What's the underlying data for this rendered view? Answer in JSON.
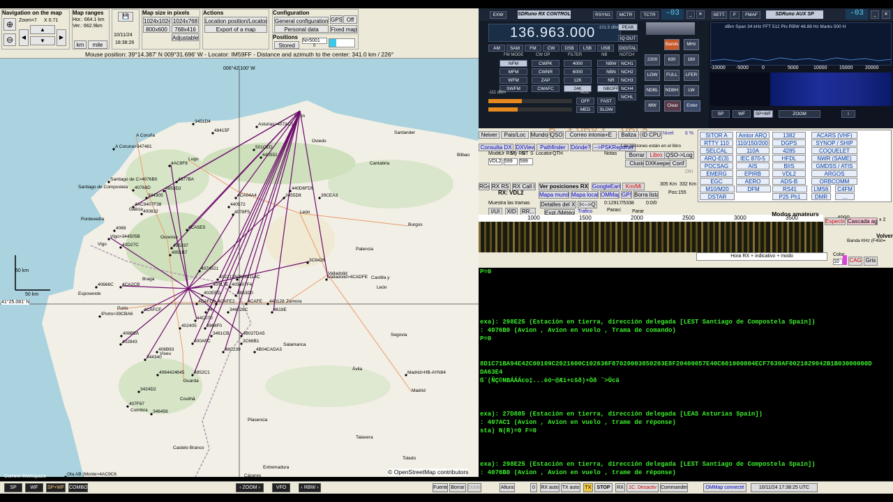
{
  "map": {
    "nav_title": "Navigation on the map",
    "zoom_readout": "Zoom=7",
    "zoom_x": "X 0.71",
    "ranges_title": "Map ranges",
    "hor": "Hor.: 664.1 km",
    "ver": "Ver.: 662.9km",
    "unit_km": "km",
    "unit_mile": "mile",
    "date": "10/11/24",
    "time": "18:38:26",
    "size_title": "Map size in pixels",
    "sizes": [
      "1024x1024",
      "1024x768",
      "800x600",
      "768x416"
    ],
    "adjustable": "Adjustable",
    "actions_title": "Actions",
    "actions": [
      "Location position/Locator",
      "Export of a map"
    ],
    "config_title": "Configuration",
    "config": [
      "General configuration",
      "Personal data"
    ],
    "gps": "GPS",
    "off": "Off",
    "fixed_map": "Fixed map",
    "positions_title": "Positions",
    "stored": "Stored",
    "n_value": "N=5001",
    "n_zero": "0",
    "mouse_pos": "Mouse position: 39°14.387' N 009°31.696' W - Locator: IM59FF - Distance and azimuth to the center: 341.0 km / 226°",
    "lon_label": "006°42.100' W",
    "lat_label": "41°25.081' N",
    "scale_v": "50 km",
    "scale_h": "50 km",
    "osm": "© OpenStreetMap contributors",
    "cities": [
      {
        "t": "A Coruña",
        "x": 195,
        "y": 112
      },
      {
        "t": "Santiago de Compostela",
        "x": 112,
        "y": 186
      },
      {
        "t": "Lugo",
        "x": 270,
        "y": 146
      },
      {
        "t": "Ourense",
        "x": 230,
        "y": 258
      },
      {
        "t": "Vigo",
        "x": 140,
        "y": 268
      },
      {
        "t": "Pontevedra",
        "x": 116,
        "y": 232
      },
      {
        "t": "Oviedo",
        "x": 447,
        "y": 120
      },
      {
        "t": "Gijón",
        "x": 422,
        "y": 84
      },
      {
        "t": "Santander",
        "x": 565,
        "y": 108
      },
      {
        "t": "Cantabria",
        "x": 530,
        "y": 152
      },
      {
        "t": "León",
        "x": 430,
        "y": 222
      },
      {
        "t": "Burgos",
        "x": 585,
        "y": 240
      },
      {
        "t": "Palencia",
        "x": 510,
        "y": 275
      },
      {
        "t": "Valladolid",
        "x": 470,
        "y": 310
      },
      {
        "t": "Zamora",
        "x": 410,
        "y": 350
      },
      {
        "t": "Salamanca",
        "x": 406,
        "y": 412
      },
      {
        "t": "Segovia",
        "x": 560,
        "y": 398
      },
      {
        "t": "Ávila",
        "x": 505,
        "y": 447
      },
      {
        "t": "Madrid",
        "x": 590,
        "y": 478
      },
      {
        "t": "Castilla y",
        "x": 532,
        "y": 316
      },
      {
        "t": "León",
        "x": 540,
        "y": 330
      },
      {
        "t": "Porto",
        "x": 168,
        "y": 360
      },
      {
        "t": "Braga",
        "x": 204,
        "y": 318
      },
      {
        "t": "Guarda",
        "x": 263,
        "y": 464
      },
      {
        "t": "Coimbra",
        "x": 187,
        "y": 506
      },
      {
        "t": "Viseu",
        "x": 229,
        "y": 425
      },
      {
        "t": "Covilhã",
        "x": 258,
        "y": 490
      },
      {
        "t": "Castelo Branco",
        "x": 248,
        "y": 560
      },
      {
        "t": "Extremadura",
        "x": 377,
        "y": 588
      },
      {
        "t": "Plasencia",
        "x": 355,
        "y": 520
      },
      {
        "t": "Cáceres",
        "x": 350,
        "y": 600
      },
      {
        "t": "Galicia",
        "x": 185,
        "y": 218
      },
      {
        "t": "Esposende",
        "x": 112,
        "y": 339
      },
      {
        "t": "Bilbao",
        "x": 655,
        "y": 140
      },
      {
        "t": "Toledo",
        "x": 577,
        "y": 575
      },
      {
        "t": "Talavera",
        "x": 510,
        "y": 545
      }
    ],
    "aircraft": [
      {
        "t": "3451D4",
        "x": 279,
        "y": 92
      },
      {
        "t": "48415F",
        "x": 307,
        "y": 105
      },
      {
        "t": "Asturias>407AC1",
        "x": 370,
        "y": 96
      },
      {
        "t": "A Coruna>347481",
        "x": 165,
        "y": 128
      },
      {
        "t": "501CED",
        "x": 366,
        "y": 129
      },
      {
        "t": "440552",
        "x": 376,
        "y": 140
      },
      {
        "t": "4AC8F8",
        "x": 245,
        "y": 152
      },
      {
        "t": "Santiago de C>4076B0",
        "x": 158,
        "y": 175
      },
      {
        "t": "4077BA",
        "x": 255,
        "y": 175
      },
      {
        "t": "40768D",
        "x": 193,
        "y": 187
      },
      {
        "t": "4853D2",
        "x": 237,
        "y": 188
      },
      {
        "t": "344305",
        "x": 212,
        "y": 198
      },
      {
        "t": "4AC9407F38",
        "x": 193,
        "y": 211
      },
      {
        "t": "440D6FD5",
        "x": 418,
        "y": 188
      },
      {
        "t": "3455D8",
        "x": 409,
        "y": 198
      },
      {
        "t": "39CEA3",
        "x": 460,
        "y": 198
      },
      {
        "t": "4CA04A4",
        "x": 340,
        "y": 198
      },
      {
        "t": "440572",
        "x": 330,
        "y": 211
      },
      {
        "t": "4078F5",
        "x": 336,
        "y": 222
      },
      {
        "t": "400832",
        "x": 205,
        "y": 221
      },
      {
        "t": "4CA5E5",
        "x": 270,
        "y": 244
      },
      {
        "t": "4069",
        "x": 166,
        "y": 245
      },
      {
        "t": "Vigo>344505B",
        "x": 158,
        "y": 257
      },
      {
        "t": "40D27C",
        "x": 175,
        "y": 269
      },
      {
        "t": "495297",
        "x": 248,
        "y": 270
      },
      {
        "t": "4951B7",
        "x": 246,
        "y": 280
      },
      {
        "t": "3C6426",
        "x": 443,
        "y": 291
      },
      {
        "t": "4074521",
        "x": 288,
        "y": 303
      },
      {
        "t": "4022135C",
        "x": 314,
        "y": 315
      },
      {
        "t": "4C84114C",
        "x": 342,
        "y": 315
      },
      {
        "t": "40717E",
        "x": 305,
        "y": 326
      },
      {
        "t": "405407F4",
        "x": 332,
        "y": 326
      },
      {
        "t": "Valladolid>4CADFE",
        "x": 470,
        "y": 315
      },
      {
        "t": "40666C",
        "x": 140,
        "y": 326
      },
      {
        "t": "4CA2CB",
        "x": 175,
        "y": 326
      },
      {
        "t": "402EED",
        "x": 292,
        "y": 338
      },
      {
        "t": "4853D0",
        "x": 340,
        "y": 338
      },
      {
        "t": "4CAFC0",
        "x": 284,
        "y": 350
      },
      {
        "t": "4CAFE2",
        "x": 312,
        "y": 350
      },
      {
        "t": "44",
        "x": 297,
        "y": 362
      },
      {
        "t": "4CAFE",
        "x": 355,
        "y": 350
      },
      {
        "t": "440128",
        "x": 386,
        "y": 350
      },
      {
        "t": "4CAFCF",
        "x": 206,
        "y": 362
      },
      {
        "t": "344028C",
        "x": 329,
        "y": 362
      },
      {
        "t": "4619E",
        "x": 392,
        "y": 362
      },
      {
        "t": "IPorto>39CBA6",
        "x": 145,
        "y": 368
      },
      {
        "t": "44C070",
        "x": 282,
        "y": 374
      },
      {
        "t": "402405",
        "x": 260,
        "y": 385
      },
      {
        "t": "3964F0",
        "x": 296,
        "y": 385
      },
      {
        "t": "3461CB",
        "x": 305,
        "y": 396
      },
      {
        "t": "4B027DA5",
        "x": 348,
        "y": 396
      },
      {
        "t": "406B5A",
        "x": 176,
        "y": 396
      },
      {
        "t": "400AFC",
        "x": 278,
        "y": 407
      },
      {
        "t": "3C66B1",
        "x": 348,
        "y": 407
      },
      {
        "t": "402843",
        "x": 175,
        "y": 408
      },
      {
        "t": "406B93",
        "x": 227,
        "y": 419
      },
      {
        "t": "48C239",
        "x": 322,
        "y": 419
      },
      {
        "t": "4B04CADA3",
        "x": 367,
        "y": 419
      },
      {
        "t": "344340",
        "x": 210,
        "y": 430
      },
      {
        "t": "4064424645",
        "x": 228,
        "y": 452
      },
      {
        "t": "4952C1",
        "x": 278,
        "y": 452
      },
      {
        "t": "Madrid>HB-AYN84",
        "x": 584,
        "y": 452
      },
      {
        "t": "3424D2",
        "x": 201,
        "y": 476
      },
      {
        "t": "407F67",
        "x": 185,
        "y": 497
      },
      {
        "t": "346456",
        "x": 219,
        "y": 508
      },
      {
        "t": "Ota AB (Monte>4AC9C6",
        "x": 96,
        "y": 598
      },
      {
        "t": "Ota AB (Monte>406ADD",
        "x": 96,
        "y": 609
      }
    ]
  },
  "radio": {
    "title": "SDRuno RX CONTROL",
    "btns_top": [
      "EXW",
      "RSYN1",
      "MCTR",
      "TCTR"
    ],
    "counter": "-03",
    "frequency": "136.963.000",
    "dbm": "-101.9 dBm",
    "peak": "PEAK",
    "iq": "IQ OUT",
    "digital": "DIGITAL",
    "modes": [
      "AM",
      "SAM",
      "FM",
      "CW",
      "DSB",
      "LSB",
      "USB"
    ],
    "fm_mode_label": "FM MODE",
    "cw_op_label": "CW OP",
    "filter_label": "FILTER",
    "nb_label": "NB",
    "notch_label": "NOTCH",
    "fm_modes": [
      "NFM",
      "MFM",
      "WFM",
      "SWFM"
    ],
    "cw_ops": [
      "CWPK",
      "CWNR",
      "ZAP",
      "CWAFC"
    ],
    "filters": [
      "4000",
      "6000",
      "12K",
      "24K"
    ],
    "nb": [
      "NBW",
      "NBN",
      "NR",
      "NBOFF"
    ],
    "notch": [
      "NCH1",
      "NCH2",
      "NCH3",
      "NCH4",
      "NCHL"
    ],
    "agc_label": "AGC",
    "agc": [
      "OFF",
      "FAST",
      "MED",
      "SLOW"
    ],
    "level": "-111 dBm",
    "keypad": [
      "Bands",
      "MHz",
      "2200",
      "630",
      "160",
      "LOW",
      "FULL",
      "LFER",
      "NDBL",
      "NDBH",
      "LW",
      "MW",
      "Clear",
      "Enter"
    ]
  },
  "spectrum": {
    "btns": [
      "SETT.",
      "F",
      "FMAF"
    ],
    "title": "SDRuno AUX SP",
    "counter": "-03",
    "info": "dBm   Span 34 kHz   FFT 512 Pts   RBW 46.88 Hz   Marks 500 H",
    "x_ticks": [
      "-10000",
      "-5000",
      "0",
      "5000",
      "10000",
      "15000",
      "20000"
    ],
    "bottom": [
      "SP",
      "WF",
      "SP+WF",
      "ZOOM"
    ]
  },
  "decoder": {
    "title_banner": "R... 1 VRX 1 ... VDL2",
    "tabs1": [
      "Neiver",
      "Pais/Loc",
      "Mundo",
      "QSO",
      "Correo intonia+E",
      "Baliza",
      "ID CPU"
    ],
    "nivel": "Nivel",
    "nivel_val": "6 %",
    "tabs2": [
      "Consulta DX",
      "DXView",
      "Pathfinder",
      "Dónde?",
      "-->PSKReporter"
    ],
    "log_note": "Las opciones están en el libro",
    "log_fields": [
      "Mode",
      "Ur RST",
      "My RST",
      "R",
      "S",
      "Locator",
      "QTH",
      "Notas"
    ],
    "log_values": [
      "VDL2",
      "599",
      "599"
    ],
    "log_btns": [
      "Borrar",
      "Libro",
      "QSO->Log",
      "Cluster",
      "DXKeeper",
      "Conf"
    ],
    "dk": "DKI",
    "rx_label": "RX: VDL2",
    "rx_tabs": [
      "RGs",
      "RX RS ID",
      "RX Call ID"
    ],
    "ver_pos": "Ver posiciones RX",
    "google_earth": "GoogleEarth",
    "km_mi": "Km/Mi",
    "mapa_mundial": "Mapa mundial",
    "mapa_local": "Mapa local",
    "omm": "OMMap",
    "gps": "GPS",
    "borra": "Borra lista",
    "dist1": "305 Km",
    "dist2": "332 Km",
    "pos": "Pos:155",
    "tramas": "Muestra las tramas",
    "detalles": "Detalles del XID",
    "arrows": "I<-->Q",
    "ratio": "0:12917/5338",
    "ratio2": "0:0/0",
    "small_btns": [
      "I/UI",
      "XID",
      "RR..."
    ],
    "expl": "Expl./Météo",
    "trafico": "Trafico",
    "paraci": "Paraci",
    "parar": "Parar",
    "ruler": [
      "1000",
      "1500",
      "2000",
      "2500",
      "3000",
      "3500",
      "4000"
    ],
    "espectro": "Espectro",
    "cascada": "Cascada agu",
    "volver": "Volver",
    "banda": "Banda KHz (F450=",
    "color": "Color",
    "color_val": "10",
    "cag": "CAG",
    "gris": "Gris",
    "hora_rx": "Hora RX + indicativo + modo",
    "modos_title": "Modos amateurs",
    "modes": [
      [
        "SITOR A",
        "Amtor ARQ",
        "1382",
        "ACARS (VHF)"
      ],
      [
        "RTTY 110",
        "110/150/200",
        "DGPS",
        "SYNOP / SHIP"
      ],
      [
        "SELCAL",
        "110A",
        "4285",
        "COQUELET"
      ],
      [
        "ARQ-E(3)",
        "IEC 870-5",
        "HFDL",
        "NWR (SAME)"
      ],
      [
        "POCSAG",
        "AIS",
        "BIIS",
        "GMDSS / ATIS"
      ],
      [
        "EMERG",
        "EPIRB",
        "VDL2",
        "ARGOS"
      ],
      [
        "EGC",
        "AERO",
        "ADS-B",
        "ORBCOMM"
      ],
      [
        "M10/M20",
        "DFM",
        "RS41",
        "LMS6",
        "C4FM"
      ],
      [
        "DSTAR",
        "",
        "P25 Ph1",
        "DMR",
        "..."
      ]
    ]
  },
  "log": {
    "lines": [
      "P=0",
      "",
      "",
      "",
      "",
      "",
      "exa): 298E25 (Estación en tierra, dirección delegada [LEST Santiago de Compostela Spain])",
      ": 4076B0 (Avion , Avion en vuelo , Trama de comando)",
      "P=0",
      "",
      "",
      "8D1C71BA94E42C00109C2021600C102636F87020003850203E8F20400057E40C601000804ECF7639AF0021029042B1B03000000D",
      "DA63E4",
      "ß`(ÑÇ©NBÁÁÁco‡...èò~@Æi+cšð)+Òð ˆ>Ücä",
      "",
      "",
      "",
      "exa): 27D885 (Estación en tierra, dirección delegada [LEAS Asturias Spain])",
      ": 407AC1 (Avion , Avion en vuelo , trame de réponse)",
      "sta) N(R)=0 F=0",
      "",
      "",
      "",
      "exa): 298E25 (Estación en tierra, dirección delegada [LEST Santiago de Compostela Spain])",
      ": 4076B0 (Avion , Avion en vuelo , trame de réponse)",
      "sta) N(R)=2 F=0"
    ]
  },
  "status": {
    "left": [
      "SP",
      "WF",
      "SP+WF",
      "COMBO"
    ],
    "zoom": "ZOOM",
    "vfo": "VFO",
    "rbw": "RBW",
    "workspace": "Current Workspace",
    "right": [
      "Fuente",
      "Borrar",
      "Doble",
      "Altura",
      "0",
      "RX auto",
      "TX auto",
      "TX",
      "STOP",
      "RX",
      "1C. Desactiv",
      "Commander",
      "OMMap connecté",
      "10/11/24 17:38:25 UTC"
    ]
  }
}
